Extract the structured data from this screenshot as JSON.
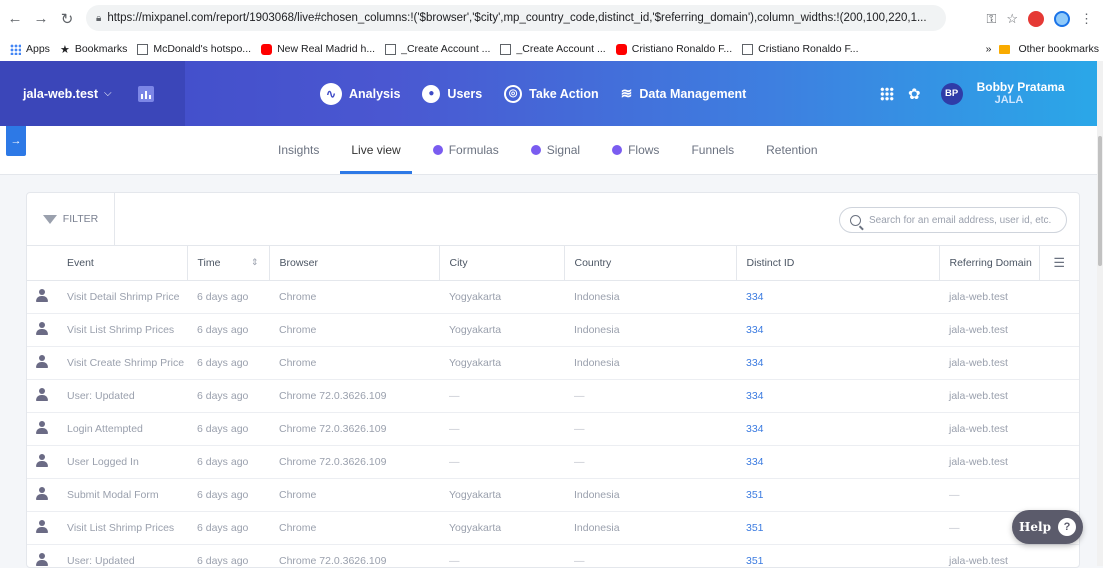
{
  "browser": {
    "url": "https://mixpanel.com/report/1903068/live#chosen_columns:!('$browser','$city',mp_country_code,distinct_id,'$referring_domain'),column_widths:!(200,100,220,1...",
    "bookmarks": [
      {
        "label": "Apps",
        "icon": "apps-icon"
      },
      {
        "label": "Bookmarks",
        "icon": "star-icon"
      },
      {
        "label": "McDonald's hotspo...",
        "icon": "page-icon"
      },
      {
        "label": "New Real Madrid h...",
        "icon": "youtube-icon"
      },
      {
        "label": "_Create Account ...",
        "icon": "page-icon"
      },
      {
        "label": "_Create Account ...",
        "icon": "page-icon"
      },
      {
        "label": "Cristiano Ronaldo F...",
        "icon": "youtube-icon"
      },
      {
        "label": "Cristiano Ronaldo F...",
        "icon": "page-icon"
      }
    ],
    "more": "»",
    "other_bookmarks": "Other bookmarks"
  },
  "header": {
    "project": "jala-web.test",
    "nav": [
      {
        "label": "Analysis",
        "icon": "analysis-icon"
      },
      {
        "label": "Users",
        "icon": "users-icon"
      },
      {
        "label": "Take Action",
        "icon": "target-icon"
      },
      {
        "label": "Data Management",
        "icon": "layers-icon"
      }
    ],
    "avatar_initials": "BP",
    "user_name": "Bobby Pratama",
    "org": "JALA"
  },
  "tabs": [
    {
      "label": "Insights",
      "dot": false,
      "active": false
    },
    {
      "label": "Live view",
      "dot": false,
      "active": true
    },
    {
      "label": "Formulas",
      "dot": true,
      "active": false
    },
    {
      "label": "Signal",
      "dot": true,
      "active": false
    },
    {
      "label": "Flows",
      "dot": true,
      "active": false
    },
    {
      "label": "Funnels",
      "dot": false,
      "active": false
    },
    {
      "label": "Retention",
      "dot": false,
      "active": false
    }
  ],
  "toolbar": {
    "filter_label": "FILTER",
    "search_placeholder": "Search for an email address, user id, etc."
  },
  "table": {
    "columns": [
      "Event",
      "Time",
      "Browser",
      "City",
      "Country",
      "Distinct ID",
      "Referring Domain"
    ],
    "rows": [
      [
        "Visit Detail Shrimp Price",
        "6 days ago",
        "Chrome",
        "Yogyakarta",
        "Indonesia",
        "334",
        "jala-web.test"
      ],
      [
        "Visit List Shrimp Prices",
        "6 days ago",
        "Chrome",
        "Yogyakarta",
        "Indonesia",
        "334",
        "jala-web.test"
      ],
      [
        "Visit Create Shrimp Price",
        "6 days ago",
        "Chrome",
        "Yogyakarta",
        "Indonesia",
        "334",
        "jala-web.test"
      ],
      [
        "User: Updated",
        "6 days ago",
        "Chrome 72.0.3626.109",
        "—",
        "—",
        "334",
        "jala-web.test"
      ],
      [
        "Login Attempted",
        "6 days ago",
        "Chrome 72.0.3626.109",
        "—",
        "—",
        "334",
        "jala-web.test"
      ],
      [
        "User Logged In",
        "6 days ago",
        "Chrome 72.0.3626.109",
        "—",
        "—",
        "334",
        "jala-web.test"
      ],
      [
        "Submit Modal Form",
        "6 days ago",
        "Chrome",
        "Yogyakarta",
        "Indonesia",
        "351",
        "—"
      ],
      [
        "Visit List Shrimp Prices",
        "6 days ago",
        "Chrome",
        "Yogyakarta",
        "Indonesia",
        "351",
        "—"
      ],
      [
        "User: Updated",
        "6 days ago",
        "Chrome 72.0.3626.109",
        "—",
        "—",
        "351",
        "jala-web.test"
      ]
    ]
  },
  "help_label": "Help",
  "colors": {
    "accent": "#2d79e6",
    "header_start": "#3e4ac6",
    "header_end": "#2aa8e8",
    "link": "#3b7be0"
  }
}
